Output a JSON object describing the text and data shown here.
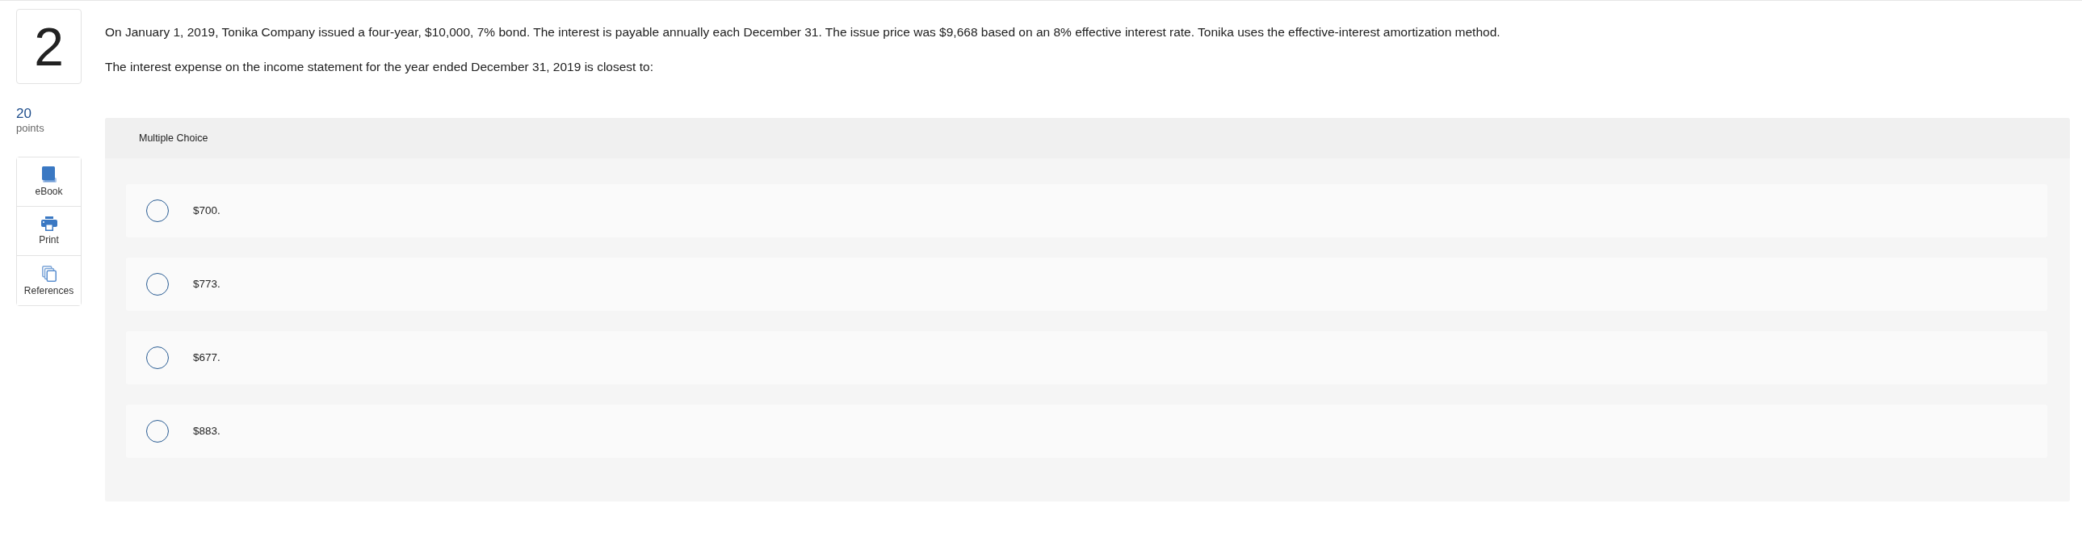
{
  "question": {
    "number": "2",
    "points": "20",
    "points_label": "points",
    "paragraphs": [
      "On January 1, 2019, Tonika Company issued a four-year, $10,000, 7% bond. The interest is payable annually each December 31. The issue price was $9,668 based on an 8% effective interest rate. Tonika uses the effective-interest amortization method.",
      "The interest expense on the income statement for the year ended December 31, 2019 is closest to:"
    ]
  },
  "tools": [
    {
      "kind": "ebook",
      "label": "eBook"
    },
    {
      "kind": "print",
      "label": "Print"
    },
    {
      "kind": "references",
      "label": "References"
    }
  ],
  "answer_panel": {
    "type_label": "Multiple Choice",
    "options": [
      {
        "label": "$700.",
        "selected": false
      },
      {
        "label": "$773.",
        "selected": false
      },
      {
        "label": "$677.",
        "selected": false
      },
      {
        "label": "$883.",
        "selected": false
      }
    ]
  }
}
